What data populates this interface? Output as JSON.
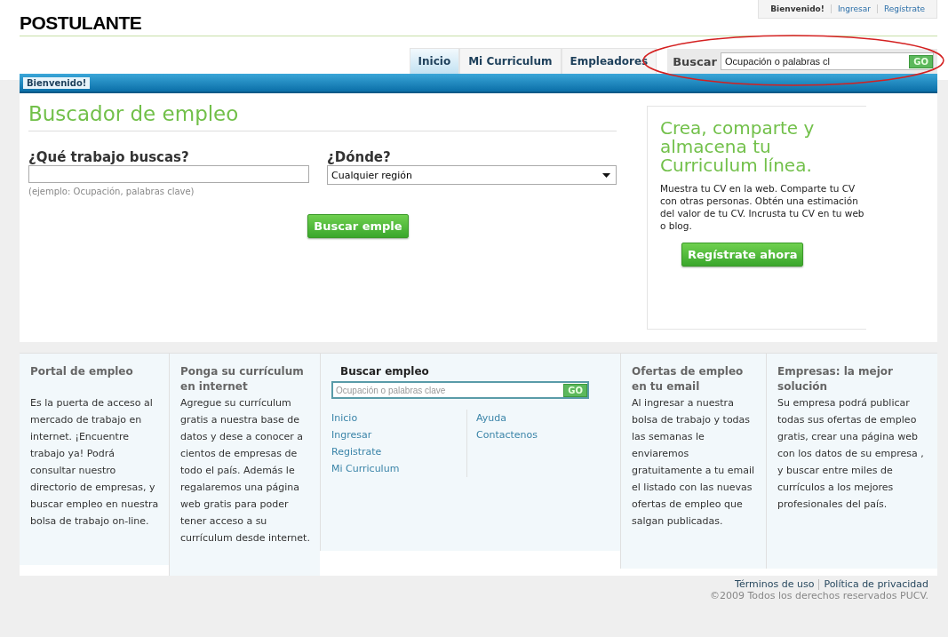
{
  "header": {
    "logo": "POSTULANTE",
    "user_links": [
      {
        "kind": "text",
        "label": "Bienvenido!"
      },
      {
        "kind": "link",
        "label": "Ingresar"
      },
      {
        "kind": "link",
        "label": "Regístrate"
      }
    ]
  },
  "tabs": [
    {
      "label": "Inicio",
      "selected": true
    },
    {
      "label": "Mi Curriculum",
      "selected": false
    },
    {
      "label": "Empleadores",
      "selected": false
    }
  ],
  "top_search": {
    "label": "Buscar",
    "value": "Ocupación o palabras cl",
    "button": "GO"
  },
  "banner": {
    "badge": "Bienvenido!"
  },
  "job_search": {
    "title": "Buscador de empleo",
    "what_label": "¿Qué trabajo buscas?",
    "what_hint": "(ejemplo: Ocupación, palabras clave)",
    "where_label": "¿Dónde?",
    "where_value": "Cualquier región",
    "button": "Buscar emple"
  },
  "promo": {
    "title": "Crea, comparte y almacena tu Curriculum línea.",
    "body": "Muestra tu CV en la web. Comparte tu CV con otras personas. Obtén una estimación del valor de tu CV. Incrusta tu CV en tu web o blog.",
    "button": "Regístrate ahora"
  },
  "footer_columns": [
    {
      "kind": "text",
      "title": "Portal de empleo",
      "body": "Es la puerta de acceso al mercado de trabajo en internet. ¡Encuentre trabajo ya! Podrá consultar nuestro directorio de empresas, y buscar empleo en nuestra bolsa de trabajo on-line."
    },
    {
      "kind": "text",
      "title": "Ponga su currículum en internet",
      "body": "Agregue su currículum gratis a nuestra base de datos y dese a conocer a cientos de empresas de todo el país. Además le regalaremos una página web gratis para poder tener acceso a su currículum desde internet."
    },
    {
      "kind": "search",
      "title": "Buscar empleo",
      "placeholder": "Ocupación o palabras clave",
      "button": "GO",
      "link_columns": [
        {
          "links": [
            "Inicio",
            "Ingresar",
            "Registrate",
            "Mi Curriculum"
          ]
        },
        {
          "links": [
            "Ayuda",
            "Contactenos"
          ]
        }
      ]
    },
    {
      "kind": "text",
      "title": "Ofertas de empleo en tu email",
      "body": "Al ingresar a nuestra bolsa de trabajo y todas las semanas le enviaremos gratuitamente a tu email el listado con las nuevas ofertas de empleo que salgan publicadas."
    },
    {
      "kind": "text",
      "title": "Empresas: la mejor solución",
      "body": "Su empresa podrá publicar todas sus ofertas de empleo gratis, crear una página web con los datos de su empresa , y buscar entre miles de currículos a los mejores profesionales del país."
    }
  ],
  "footer": {
    "links": [
      "Términos de uso",
      "Política de privacidad"
    ],
    "copyright": "©2009 Todos los derechos reservados PUCV."
  }
}
